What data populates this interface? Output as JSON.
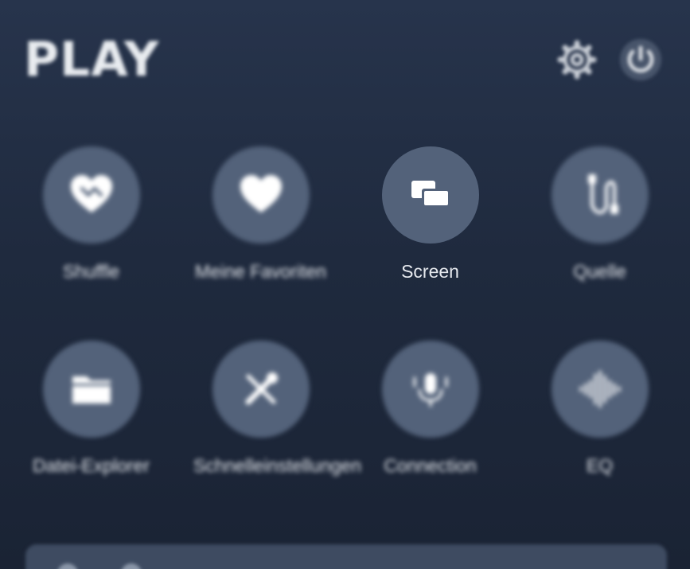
{
  "app": {
    "brand_title": "PLAY"
  },
  "header": {
    "settings_icon": "gear-icon",
    "power_icon": "power-icon"
  },
  "tiles": [
    {
      "label": "Shuffle",
      "icon": "heart-shuffle-icon"
    },
    {
      "label": "Meine Favoriten",
      "icon": "heart-icon"
    },
    {
      "label": "Screen",
      "icon": "screen-mirror-icon"
    },
    {
      "label": "Quelle",
      "icon": "cable-source-icon"
    },
    {
      "label": "Datei-Explorer",
      "icon": "folder-icon"
    },
    {
      "label": "Schnelleinstellungen",
      "icon": "tools-icon"
    },
    {
      "label": "Connection",
      "icon": "microphone-icon"
    },
    {
      "label": "EQ",
      "icon": "waveform-icon"
    }
  ],
  "colors": {
    "background_top": "#27344c",
    "background_bottom": "#1a2334",
    "tile_circle": "#53627a",
    "text": "#e6e9ee"
  }
}
